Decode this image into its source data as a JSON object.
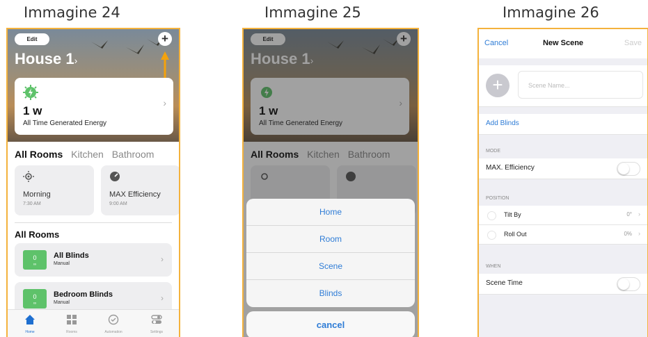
{
  "captions": [
    "Immagine 24",
    "Immagine 25",
    "Immagine 26"
  ],
  "home": {
    "edit_label": "Edit",
    "add_icon": "plus-icon",
    "house_title": "House 1",
    "energy": {
      "value": "1 w",
      "label": "All Time Generated Energy",
      "icon": "energy-bolt-icon"
    },
    "tabs": [
      "All Rooms",
      "Kitchen",
      "Bathroom"
    ],
    "scenes": [
      {
        "name": "Morning",
        "time": "7:30 AM",
        "icon": "sun-icon"
      },
      {
        "name": "MAX Efficiency",
        "time": "9:00 AM",
        "icon": "gauge-icon"
      }
    ],
    "section_title": "All Rooms",
    "blinds": [
      {
        "name": "All Blinds",
        "mode": "Manual",
        "percent": "0"
      },
      {
        "name": "Bedroom Blinds",
        "mode": "Manual",
        "percent": "0"
      }
    ],
    "tabbar": [
      {
        "label": "Home",
        "icon": "home-icon"
      },
      {
        "label": "Rooms",
        "icon": "grid-icon"
      },
      {
        "label": "Automation",
        "icon": "clock-icon"
      },
      {
        "label": "Settings",
        "icon": "toggles-icon"
      }
    ]
  },
  "action_sheet": {
    "options": [
      "Home",
      "Room",
      "Scene",
      "Blinds"
    ],
    "cancel_label": "cancel"
  },
  "new_scene": {
    "cancel_label": "Cancel",
    "title": "New Scene",
    "save_label": "Save",
    "name_placeholder": "Scene Name...",
    "add_blinds_label": "Add Blinds",
    "mode_section": "MODE",
    "mode_option": "MAX. Efficiency",
    "mode_enabled": false,
    "position_section": "POSITION",
    "positions": [
      {
        "label": "Tilt By",
        "value": "0°"
      },
      {
        "label": "Roll Out",
        "value": "0%"
      }
    ],
    "when_section": "WHEN",
    "scene_time_label": "Scene Time",
    "scene_time_enabled": false
  },
  "colors": {
    "accent": "#2e7cd6",
    "frame": "#f4b23c",
    "badge": "#5ec26a",
    "arrow": "#f4a20c"
  }
}
